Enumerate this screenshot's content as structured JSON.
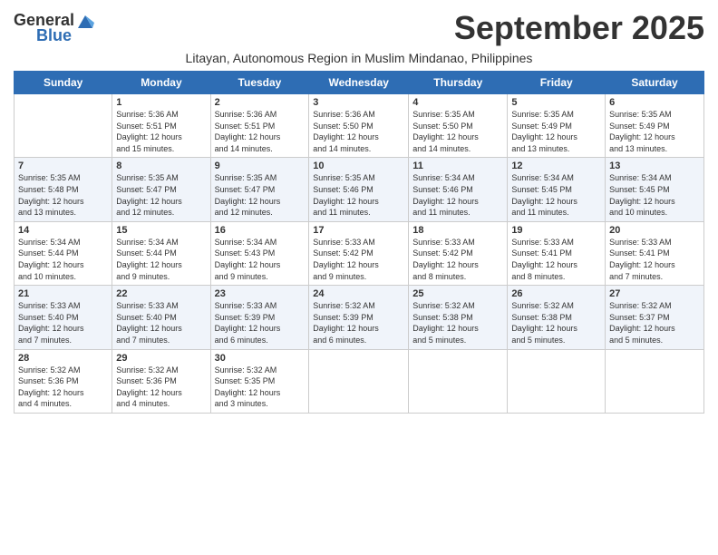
{
  "logo": {
    "general": "General",
    "blue": "Blue"
  },
  "title": "September 2025",
  "subtitle": "Litayan, Autonomous Region in Muslim Mindanao, Philippines",
  "days_of_week": [
    "Sunday",
    "Monday",
    "Tuesday",
    "Wednesday",
    "Thursday",
    "Friday",
    "Saturday"
  ],
  "weeks": [
    [
      {
        "day": "",
        "info": ""
      },
      {
        "day": "1",
        "info": "Sunrise: 5:36 AM\nSunset: 5:51 PM\nDaylight: 12 hours\nand 15 minutes."
      },
      {
        "day": "2",
        "info": "Sunrise: 5:36 AM\nSunset: 5:51 PM\nDaylight: 12 hours\nand 14 minutes."
      },
      {
        "day": "3",
        "info": "Sunrise: 5:36 AM\nSunset: 5:50 PM\nDaylight: 12 hours\nand 14 minutes."
      },
      {
        "day": "4",
        "info": "Sunrise: 5:35 AM\nSunset: 5:50 PM\nDaylight: 12 hours\nand 14 minutes."
      },
      {
        "day": "5",
        "info": "Sunrise: 5:35 AM\nSunset: 5:49 PM\nDaylight: 12 hours\nand 13 minutes."
      },
      {
        "day": "6",
        "info": "Sunrise: 5:35 AM\nSunset: 5:49 PM\nDaylight: 12 hours\nand 13 minutes."
      }
    ],
    [
      {
        "day": "7",
        "info": "Sunrise: 5:35 AM\nSunset: 5:48 PM\nDaylight: 12 hours\nand 13 minutes."
      },
      {
        "day": "8",
        "info": "Sunrise: 5:35 AM\nSunset: 5:47 PM\nDaylight: 12 hours\nand 12 minutes."
      },
      {
        "day": "9",
        "info": "Sunrise: 5:35 AM\nSunset: 5:47 PM\nDaylight: 12 hours\nand 12 minutes."
      },
      {
        "day": "10",
        "info": "Sunrise: 5:35 AM\nSunset: 5:46 PM\nDaylight: 12 hours\nand 11 minutes."
      },
      {
        "day": "11",
        "info": "Sunrise: 5:34 AM\nSunset: 5:46 PM\nDaylight: 12 hours\nand 11 minutes."
      },
      {
        "day": "12",
        "info": "Sunrise: 5:34 AM\nSunset: 5:45 PM\nDaylight: 12 hours\nand 11 minutes."
      },
      {
        "day": "13",
        "info": "Sunrise: 5:34 AM\nSunset: 5:45 PM\nDaylight: 12 hours\nand 10 minutes."
      }
    ],
    [
      {
        "day": "14",
        "info": "Sunrise: 5:34 AM\nSunset: 5:44 PM\nDaylight: 12 hours\nand 10 minutes."
      },
      {
        "day": "15",
        "info": "Sunrise: 5:34 AM\nSunset: 5:44 PM\nDaylight: 12 hours\nand 9 minutes."
      },
      {
        "day": "16",
        "info": "Sunrise: 5:34 AM\nSunset: 5:43 PM\nDaylight: 12 hours\nand 9 minutes."
      },
      {
        "day": "17",
        "info": "Sunrise: 5:33 AM\nSunset: 5:42 PM\nDaylight: 12 hours\nand 9 minutes."
      },
      {
        "day": "18",
        "info": "Sunrise: 5:33 AM\nSunset: 5:42 PM\nDaylight: 12 hours\nand 8 minutes."
      },
      {
        "day": "19",
        "info": "Sunrise: 5:33 AM\nSunset: 5:41 PM\nDaylight: 12 hours\nand 8 minutes."
      },
      {
        "day": "20",
        "info": "Sunrise: 5:33 AM\nSunset: 5:41 PM\nDaylight: 12 hours\nand 7 minutes."
      }
    ],
    [
      {
        "day": "21",
        "info": "Sunrise: 5:33 AM\nSunset: 5:40 PM\nDaylight: 12 hours\nand 7 minutes."
      },
      {
        "day": "22",
        "info": "Sunrise: 5:33 AM\nSunset: 5:40 PM\nDaylight: 12 hours\nand 7 minutes."
      },
      {
        "day": "23",
        "info": "Sunrise: 5:33 AM\nSunset: 5:39 PM\nDaylight: 12 hours\nand 6 minutes."
      },
      {
        "day": "24",
        "info": "Sunrise: 5:32 AM\nSunset: 5:39 PM\nDaylight: 12 hours\nand 6 minutes."
      },
      {
        "day": "25",
        "info": "Sunrise: 5:32 AM\nSunset: 5:38 PM\nDaylight: 12 hours\nand 5 minutes."
      },
      {
        "day": "26",
        "info": "Sunrise: 5:32 AM\nSunset: 5:38 PM\nDaylight: 12 hours\nand 5 minutes."
      },
      {
        "day": "27",
        "info": "Sunrise: 5:32 AM\nSunset: 5:37 PM\nDaylight: 12 hours\nand 5 minutes."
      }
    ],
    [
      {
        "day": "28",
        "info": "Sunrise: 5:32 AM\nSunset: 5:36 PM\nDaylight: 12 hours\nand 4 minutes."
      },
      {
        "day": "29",
        "info": "Sunrise: 5:32 AM\nSunset: 5:36 PM\nDaylight: 12 hours\nand 4 minutes."
      },
      {
        "day": "30",
        "info": "Sunrise: 5:32 AM\nSunset: 5:35 PM\nDaylight: 12 hours\nand 3 minutes."
      },
      {
        "day": "",
        "info": ""
      },
      {
        "day": "",
        "info": ""
      },
      {
        "day": "",
        "info": ""
      },
      {
        "day": "",
        "info": ""
      }
    ]
  ]
}
